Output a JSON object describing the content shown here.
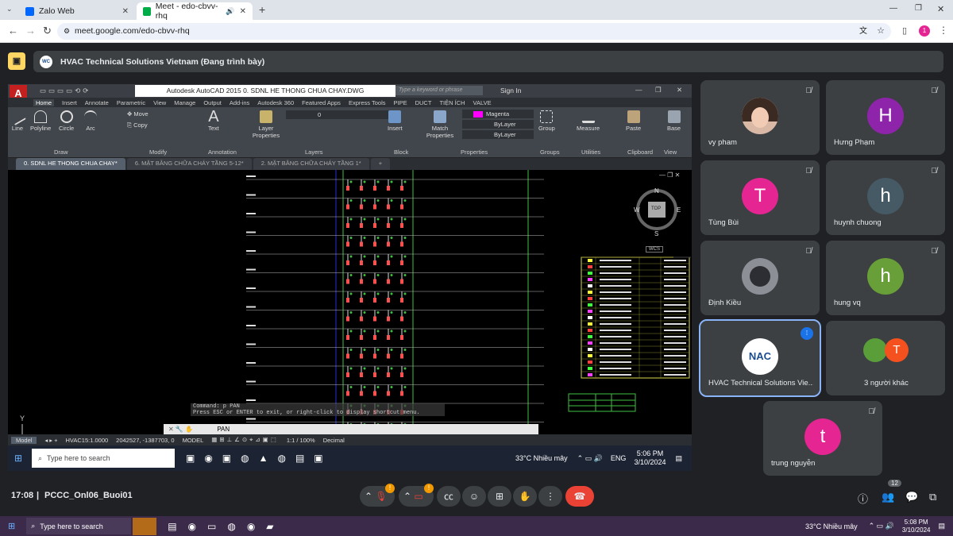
{
  "browser": {
    "tabs": [
      {
        "title": "Zalo Web",
        "color": "#0068ff"
      },
      {
        "title": "Meet - edo-cbvv-rhq",
        "color": "#00ac47"
      }
    ],
    "url": "meet.google.com/edo-cbvv-rhq",
    "profile_initial": "1"
  },
  "meet": {
    "presenter_text": "HVAC Technical Solutions Vietnam (Đang trình bày)",
    "logo_text": "WC",
    "time": "17:08",
    "meeting_code": "PCCC_Onl06_Buoi01",
    "participant_count": "12"
  },
  "autocad": {
    "app_title": "Autodesk AutoCAD 2015",
    "file_title": "0. SDNL HE THONG CHUA CHAY.DWG",
    "search_placeholder": "Type a keyword or phrase",
    "sign_in": "Sign In",
    "ribbon_tabs": [
      "Home",
      "Insert",
      "Annotate",
      "Parametric",
      "View",
      "Manage",
      "Output",
      "Add-ins",
      "Autodesk 360",
      "Featured Apps",
      "Express Tools",
      "PIPE",
      "DUCT",
      "TIỆN ÍCH",
      "VALVE"
    ],
    "draw_buttons": [
      "Line",
      "Polyline",
      "Circle",
      "Arc"
    ],
    "modify_buttons": [
      "Move",
      "Copy"
    ],
    "annotation_buttons": [
      "Text"
    ],
    "layer_buttons": [
      "Layer Properties"
    ],
    "block_buttons": [
      "Insert"
    ],
    "properties_buttons": [
      "Match Properties"
    ],
    "group_buttons": [
      "Group"
    ],
    "utility_buttons": [
      "Measure"
    ],
    "clipboard_buttons": [
      "Paste"
    ],
    "view_buttons": [
      "Base"
    ],
    "groups": [
      "Draw",
      "Modify",
      "Annotation",
      "Layers",
      "Block",
      "Properties",
      "Groups",
      "Utilities",
      "Clipboard",
      "View"
    ],
    "layer_value": "0",
    "color_value": "Magenta",
    "bylayer1": "ByLayer",
    "bylayer2": "ByLayer",
    "doc_tabs": [
      "0. SDNL HE THONG CHUA CHAY*",
      "6. MẶT BẰNG CHỮA CHÁY TẦNG 5-12*",
      "2. MẶT BẰNG CHỮA CHÁY TẦNG 1*"
    ],
    "viewcube": {
      "n": "N",
      "s": "S",
      "e": "E",
      "w": "W",
      "top": "TOP",
      "wcs": "WCS"
    },
    "axis_y": "Y",
    "command_history1": "Command: p PAN",
    "command_history2": "Press ESC or ENTER to exit, or right-click to display shortcut menu.",
    "command_current": "PAN",
    "status_model": "Model",
    "status_scale": "HVAC15:1.0000",
    "status_coords": "2042527, -1387703, 0",
    "status_space": "MODEL",
    "status_zoom": "1:1 / 100%",
    "status_units": "Decimal"
  },
  "inner_taskbar": {
    "search_placeholder": "Type here to search",
    "weather": "33°C  Nhiều mây",
    "lang": "ENG",
    "time": "5:06 PM",
    "date": "3/10/2024"
  },
  "participants": [
    {
      "name": "vy pham",
      "initial": "",
      "color": "#d9b8a6",
      "photo": true
    },
    {
      "name": "Hưng Phạm",
      "initial": "H",
      "color": "#8e24aa"
    },
    {
      "name": "Tùng Bùi",
      "initial": "T",
      "color": "#e52592"
    },
    {
      "name": "huynh chuong",
      "initial": "h",
      "color": "#455a64"
    },
    {
      "name": "Định Kiều",
      "initial": "",
      "color": "#6b6e77",
      "photo": true
    },
    {
      "name": "hung vq",
      "initial": "h",
      "color": "#689f38"
    },
    {
      "name": "HVAC Technical Solutions Vie...",
      "initial": "",
      "color": "#ffffff",
      "logo": "NAC"
    },
    {
      "name": "3 người khác",
      "initial": "T",
      "color": "#f4511e"
    },
    {
      "name": "trung nguyễn",
      "initial": "t",
      "color": "#e52592"
    }
  ],
  "os_taskbar": {
    "search_placeholder": "Type here to search",
    "weather": "33°C  Nhiều mây",
    "time": "5:08 PM",
    "date": "3/10/2024"
  }
}
